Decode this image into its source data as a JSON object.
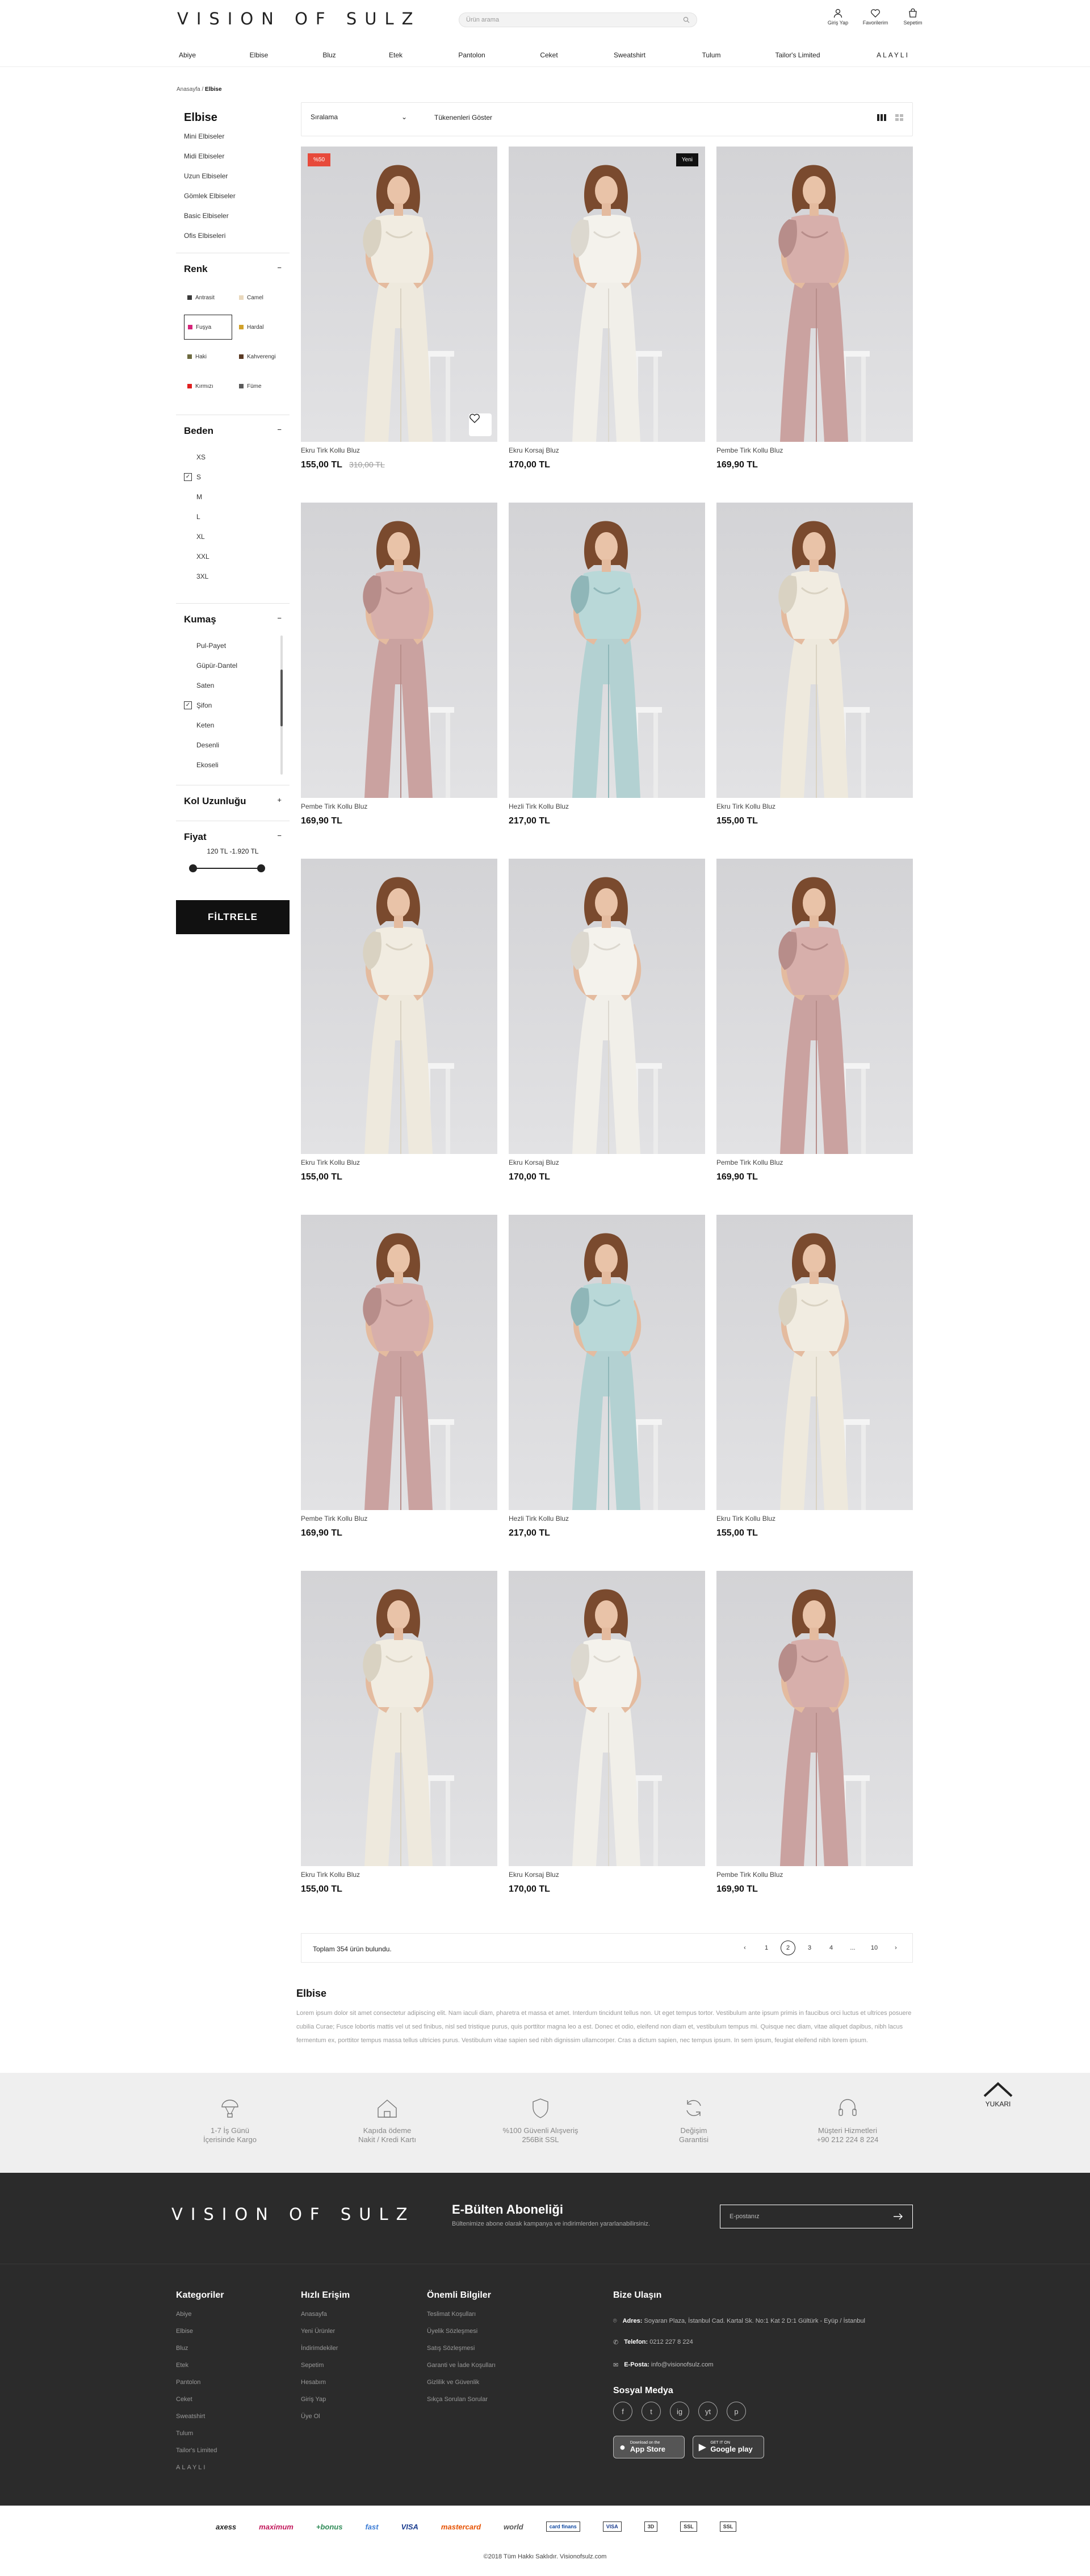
{
  "header": {
    "logo": "VISION OF SULZ",
    "search_placeholder": "Ürün arama",
    "icons": [
      {
        "label": "Giriş Yap",
        "icon": "user-icon"
      },
      {
        "label": "Favorilerim",
        "icon": "heart-icon"
      },
      {
        "label": "Sepetim",
        "icon": "cart-icon"
      }
    ]
  },
  "nav": [
    "Abiye",
    "Elbise",
    "Bluz",
    "Etek",
    "Pantolon",
    "Ceket",
    "Sweatshirt",
    "Tulum",
    "Tailor's Limited",
    "ALAYLI"
  ],
  "breadcrumb": {
    "home": "Anasayfa",
    "current": "Elbise"
  },
  "sidebar": {
    "title": "Elbise",
    "links": [
      "Mini Elbiseler",
      "Midi Elbiseler",
      "Uzun Elbiseler",
      "Gömlek Elbiseler",
      "Basic Elbiseler",
      "Ofis Elbiseleri"
    ],
    "color_title": "Renk",
    "colors": [
      {
        "name": "Antrasit",
        "hex": "#3a3a3a"
      },
      {
        "name": "Camel",
        "hex": "#e9d8bd"
      },
      {
        "name": "Fuşya",
        "hex": "#d6247a",
        "selected": true
      },
      {
        "name": "Hardal",
        "hex": "#d1a12a"
      },
      {
        "name": "Haki",
        "hex": "#6d6a3f"
      },
      {
        "name": "Kahverengi",
        "hex": "#5a3a24"
      },
      {
        "name": "Kırmızı",
        "hex": "#e02020"
      },
      {
        "name": "Füme",
        "hex": "#5b5b5b"
      }
    ],
    "size_title": "Beden",
    "sizes": [
      {
        "name": "XS"
      },
      {
        "name": "S",
        "checked": true
      },
      {
        "name": "M"
      },
      {
        "name": "L"
      },
      {
        "name": "XL"
      },
      {
        "name": "XXL"
      },
      {
        "name": "3XL"
      }
    ],
    "fabric_title": "Kumaş",
    "fabrics": [
      {
        "name": "Pul-Payet"
      },
      {
        "name": "Güpür-Dantel"
      },
      {
        "name": "Saten"
      },
      {
        "name": "Şifon",
        "checked": true
      },
      {
        "name": "Keten"
      },
      {
        "name": "Desenli"
      },
      {
        "name": "Ekoseli"
      }
    ],
    "sleeve_title": "Kol Uzunluğu",
    "price_title": "Fiyat",
    "price_range": "120 TL -1.920 TL",
    "price_range_fraction": [
      0.0,
      1.0
    ],
    "filter_button": "FİLTRELE"
  },
  "toolbar": {
    "sort_label": "Sıralama",
    "show_all": "Tükenenleri Göster"
  },
  "products": [
    {
      "name": "Ekru Tirk Kollu Bluz",
      "price": "155,00 TL",
      "old_price": "310,00 TL",
      "badge": "%50",
      "badge_type": "sale",
      "dress": "cream"
    },
    {
      "name": "Ekru Korsaj Bluz",
      "price": "170,00 TL",
      "old_price": "",
      "badge": "Yeni",
      "badge_type": "new",
      "dress": "white"
    },
    {
      "name": "Pembe Tirk Kollu Bluz",
      "price": "169,90 TL",
      "old_price": "",
      "badge": "",
      "badge_type": "",
      "dress": "pink"
    },
    {
      "name": "Pembe Tirk Kollu Bluz",
      "price": "169,90 TL",
      "old_price": "",
      "badge": "",
      "badge_type": "",
      "dress": "pink"
    },
    {
      "name": "Hezli Tirk Kollu Bluz",
      "price": "217,00 TL",
      "old_price": "",
      "badge": "",
      "badge_type": "",
      "dress": "blue"
    },
    {
      "name": "Ekru Tirk Kollu Bluz",
      "price": "155,00 TL",
      "old_price": "",
      "badge": "",
      "badge_type": "",
      "dress": "cream"
    },
    {
      "name": "Ekru Tirk Kollu Bluz",
      "price": "155,00 TL",
      "old_price": "",
      "badge": "",
      "badge_type": "",
      "dress": "cream"
    },
    {
      "name": "Ekru Korsaj Bluz",
      "price": "170,00 TL",
      "old_price": "",
      "badge": "",
      "badge_type": "",
      "dress": "white"
    },
    {
      "name": "Pembe Tirk Kollu Bluz",
      "price": "169,90 TL",
      "old_price": "",
      "badge": "",
      "badge_type": "",
      "dress": "pink"
    },
    {
      "name": "Pembe Tirk Kollu Bluz",
      "price": "169,90 TL",
      "old_price": "",
      "badge": "",
      "badge_type": "",
      "dress": "pink"
    },
    {
      "name": "Hezli Tirk Kollu Bluz",
      "price": "217,00 TL",
      "old_price": "",
      "badge": "",
      "badge_type": "",
      "dress": "blue"
    },
    {
      "name": "Ekru Tirk Kollu Bluz",
      "price": "155,00 TL",
      "old_price": "",
      "badge": "",
      "badge_type": "",
      "dress": "cream"
    },
    {
      "name": "Ekru Tirk Kollu Bluz",
      "price": "155,00 TL",
      "old_price": "",
      "badge": "",
      "badge_type": "",
      "dress": "cream"
    },
    {
      "name": "Ekru Korsaj Bluz",
      "price": "170,00 TL",
      "old_price": "",
      "badge": "",
      "badge_type": "",
      "dress": "white"
    },
    {
      "name": "Pembe Tirk Kollu Bluz",
      "price": "169,90 TL",
      "old_price": "",
      "badge": "",
      "badge_type": "",
      "dress": "pink"
    }
  ],
  "pagination": {
    "total_text": "Toplam 354 ürün bulundu.",
    "pages": [
      "1",
      "2",
      "3",
      "4",
      "...",
      "10"
    ],
    "current": "2"
  },
  "description": {
    "title": "Elbise",
    "text": "Lorem ipsum dolor sit amet consectetur adipiscing elit. Nam iaculi diam, pharetra et massa et amet. Interdum tincidunt tellus non. Ut eget tempus tortor. Vestibulum ante ipsum primis in faucibus orci luctus et ultrices posuere cubilia Curae; Fusce lobortis mattis vel ut sed finibus, nisl sed tristique purus, quis porttitor magna leo a est. Donec et odio, eleifend non diam et, vestibulum tempus mi. Quisque nec diam, vitae aliquet dapibus, nibh lacus fermentum ex, porttitor tempus massa tellus ultricies purus. Vestibulum vitae sapien sed nibh dignissim ullamcorper. Cras a dictum sapien, nec tempus ipsum. In sem ipsum, feugiat eleifend nibh lorem ipsum."
  },
  "features": [
    {
      "line1": "1-7 İş Günü",
      "line2": "İçerisinde Kargo",
      "icon": "balloon-icon"
    },
    {
      "line1": "Kapıda ödeme",
      "line2": "Nakit / Kredi Kartı",
      "icon": "house-icon"
    },
    {
      "line1": "%100 Güvenli Alışveriş",
      "line2": "256Bit SSL",
      "icon": "shield-icon"
    },
    {
      "line1": "Değişim",
      "line2": "Garantisi",
      "icon": "refresh-icon"
    },
    {
      "line1": "Müşteri Hizmetleri",
      "line2": "+90 212 224 8 224",
      "icon": "headset-icon"
    }
  ],
  "to_top": "YUKARI",
  "subscribe": {
    "logo": "VISION OF SULZ",
    "title": "E-Bülten Aboneliği",
    "subtitle": "Bültenimize abone olarak kampanya ve indirimlerden yararlanabilirsiniz.",
    "placeholder": "E-postanız"
  },
  "footer": {
    "categories_title": "Kategoriler",
    "categories": [
      "Abiye",
      "Elbise",
      "Bluz",
      "Etek",
      "Pantolon",
      "Ceket",
      "Sweatshirt",
      "Tulum",
      "Tailor's Limited",
      "ALAYLI"
    ],
    "quick_title": "Hızlı Erişim",
    "quick": [
      "Anasayfa",
      "Yeni Ürünler",
      "İndirimdekiler",
      "Sepetim",
      "Hesabım",
      "Giriş Yap",
      "Üye Ol"
    ],
    "info_title": "Önemli Bilgiler",
    "info": [
      "Teslimat Koşulları",
      "Üyelik Sözleşmesi",
      "Satış Sözleşmesi",
      "Garanti ve İade Koşulları",
      "Gizlilik ve Güvenlik",
      "Sıkça Sorulan Sorular"
    ],
    "contact_title": "Bize Ulaşın",
    "address_label": "Adres:",
    "address": "Soyaran Plaza, İstanbul Cad. Kartal Sk. No:1 Kat 2 D:1 Gültürk - Eyüp / İstanbul",
    "phone_label": "Telefon:",
    "phone": "0212 227 8 224",
    "email_label": "E-Posta:",
    "email": "info@visionofsulz.com",
    "social_title": "Sosyal Medya",
    "social": [
      "f",
      "t",
      "ig",
      "yt",
      "p"
    ],
    "app_store_small": "Download on the",
    "app_store": "App Store",
    "google_play_small": "GET IT ON",
    "google_play": "Google play"
  },
  "payment_logos": [
    "axess",
    "maximum",
    "+bonus",
    "fast",
    "VISA",
    "mastercard",
    "world",
    "card finans",
    "VISA",
    "3D",
    "SSL",
    "SSL"
  ],
  "copyright": "©2018 Tüm Hakkı Saklıdır. Visionofsulz.com"
}
